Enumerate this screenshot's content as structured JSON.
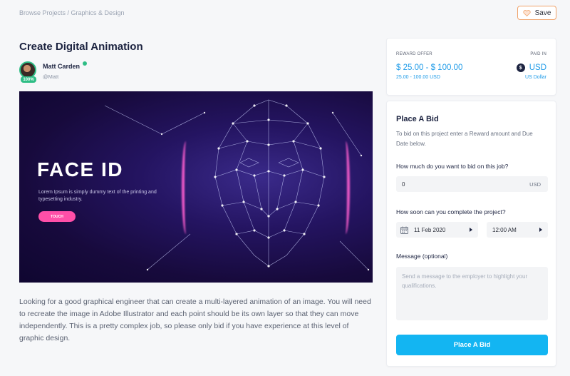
{
  "breadcrumb": "Browse Projects / Graphics & Design",
  "save_button": {
    "label": "Save",
    "icon": "heart-icon",
    "border_color": "#f0a36b"
  },
  "project": {
    "title": "Create Digital Animation",
    "author": {
      "name": "Matt Carden",
      "handle": "@Matt",
      "badge": "100%"
    },
    "image": {
      "headline": "FACE ID",
      "text": "Lorem Ipsum is simply dummy text of the printing and typesetting industry.",
      "button": "TOUCH"
    },
    "description": "Looking for a good graphical engineer that can create a multi-layered animation of an image. You will need to recreate the image in Adobe Illustrator and each point should be its own layer so that they can move independently. This is a pretty complex job, so please only bid if you have experience at this level of graphic design."
  },
  "reward": {
    "label": "REWARD OFFER",
    "amount": "$ 25.00 - $ 100.00",
    "amount_sub": "25.00 - 100.00 USD",
    "paid_in_label": "PAID IN",
    "currency": "USD",
    "currency_name": "US Dollar",
    "currency_icon": "dollar-icon",
    "accent": "#1e9be8"
  },
  "bid": {
    "title": "Place A Bid",
    "help": "To bid on this project enter a Reward amount and Due Date below.",
    "amount_label": "How much do you want to bid on this job?",
    "amount_value": "0",
    "amount_unit": "USD",
    "date_label": "How soon can you complete the project?",
    "date_value": "11 Feb 2020",
    "time_value": "12:00 AM",
    "message_label": "Message (optional)",
    "message_placeholder": "Send a message to the employer to highlight your qualifications.",
    "submit": "Place A Bid",
    "submit_color": "#13b5f2"
  }
}
